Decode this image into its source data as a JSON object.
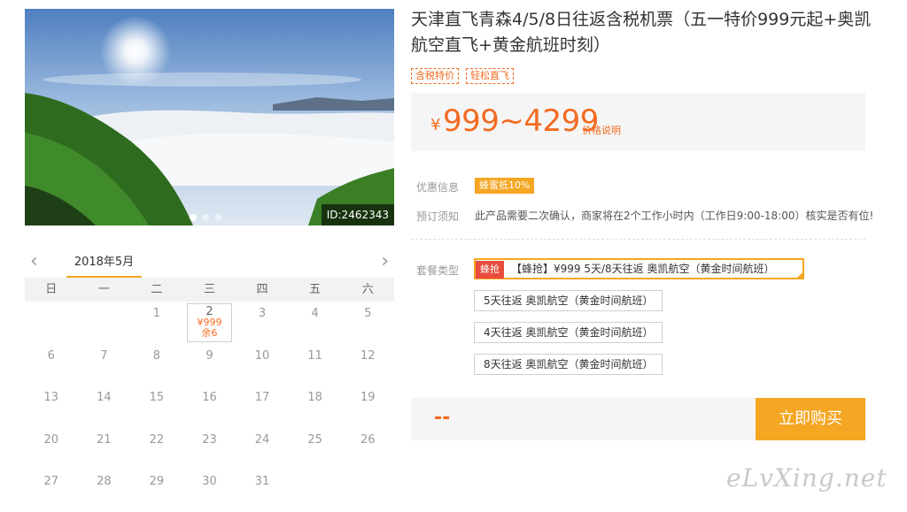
{
  "hero": {
    "image_id": "ID:2462343",
    "slides": 3,
    "active_slide": 1
  },
  "calendar": {
    "month": "2018年5月",
    "prev_icon": "chevron-left-icon",
    "next_icon": "chevron-right-icon",
    "weekdays": [
      "日",
      "一",
      "二",
      "三",
      "四",
      "五",
      "六"
    ],
    "leading_blanks": 2,
    "days": [
      "1",
      "2",
      "3",
      "4",
      "5",
      "6",
      "7",
      "8",
      "9",
      "10",
      "11",
      "12",
      "13",
      "14",
      "15",
      "16",
      "17",
      "18",
      "19",
      "20",
      "21",
      "22",
      "23",
      "24",
      "25",
      "26",
      "27",
      "28",
      "29",
      "30",
      "31"
    ],
    "available": {
      "day": "2",
      "price": "¥999",
      "stock": "余6"
    }
  },
  "product": {
    "title": "天津直飞青森4/5/8日往返含税机票（五一特价999元起+奥凯航空直飞+黄金航班时刻）",
    "tags": [
      "含税特价",
      "轻松直飞"
    ],
    "price_currency": "¥",
    "price_range": "999~4299",
    "price_note": "价格说明"
  },
  "info": {
    "promo_label": "优惠信息",
    "promo_badge": "蜂蜜抵10%",
    "notice_label": "预订须知",
    "notice_text": "此产品需要二次确认，商家将在2个工作小时内（工作日9:00-18:00）核实是否有位!"
  },
  "packages": {
    "label": "套餐类型",
    "selected_badge": "蜂抢",
    "items": [
      "【蜂抢】¥999 5天/8天往返 奥凯航空（黄金时间航班）",
      "5天往返 奥凯航空（黄金时间航班）",
      "4天往返 奥凯航空（黄金时间航班）",
      "8天往返 奥凯航空（黄金时间航班）"
    ]
  },
  "purchase": {
    "total": "--",
    "buy_label": "立即购买"
  },
  "watermark": "eLvXing.net",
  "colors": {
    "accent_orange": "#f5a623",
    "price_orange": "#f36b21",
    "badge_red": "#e74c3c"
  }
}
